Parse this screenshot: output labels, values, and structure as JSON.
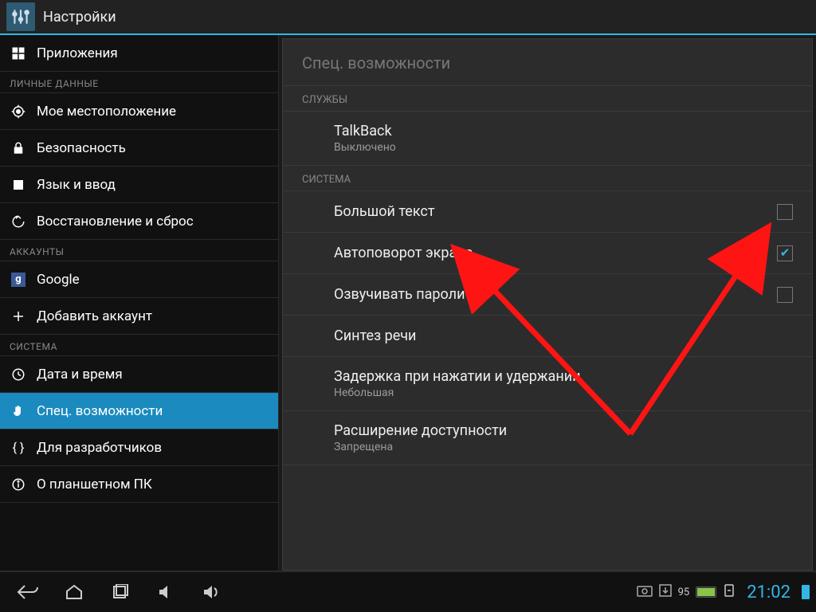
{
  "app": {
    "title": "Настройки"
  },
  "sidebar": {
    "top_items": [
      {
        "label": "Приложения",
        "icon": "apps"
      }
    ],
    "sections": [
      {
        "header": "ЛИЧНЫЕ ДАННЫЕ",
        "items": [
          {
            "label": "Мое местоположение",
            "icon": "location"
          },
          {
            "label": "Безопасность",
            "icon": "lock"
          },
          {
            "label": "Язык и ввод",
            "icon": "language"
          },
          {
            "label": "Восстановление и сброс",
            "icon": "backup"
          }
        ]
      },
      {
        "header": "АККАУНТЫ",
        "items": [
          {
            "label": "Google",
            "icon": "google"
          },
          {
            "label": "Добавить аккаунт",
            "icon": "plus"
          }
        ]
      },
      {
        "header": "СИСТЕМА",
        "items": [
          {
            "label": "Дата и время",
            "icon": "clock"
          },
          {
            "label": "Спец. возможности",
            "icon": "hand",
            "selected": true
          },
          {
            "label": "Для разработчиков",
            "icon": "braces"
          },
          {
            "label": "О планшетном ПК",
            "icon": "info"
          }
        ]
      }
    ]
  },
  "content": {
    "title": "Спец. возможности",
    "sections": [
      {
        "header": "СЛУЖБЫ",
        "items": [
          {
            "title": "TalkBack",
            "subtitle": "Выключено",
            "checkbox": null
          }
        ]
      },
      {
        "header": "СИСТЕМА",
        "items": [
          {
            "title": "Большой текст",
            "checkbox": false
          },
          {
            "title": "Автоповорот экрана",
            "checkbox": true
          },
          {
            "title": "Озвучивать пароли",
            "checkbox": false
          },
          {
            "title": "Синтез речи",
            "checkbox": null
          },
          {
            "title": "Задержка при нажатии и удержании",
            "subtitle": "Небольшая",
            "checkbox": null
          },
          {
            "title": "Расширение доступности",
            "subtitle": "Запрещена",
            "checkbox": null
          }
        ]
      }
    ]
  },
  "navbar": {
    "battery_percent": "95",
    "battery_indicator": "95",
    "clock": "21:02"
  },
  "colors": {
    "accent": "#33b5e5",
    "selection": "#1a8abf"
  }
}
